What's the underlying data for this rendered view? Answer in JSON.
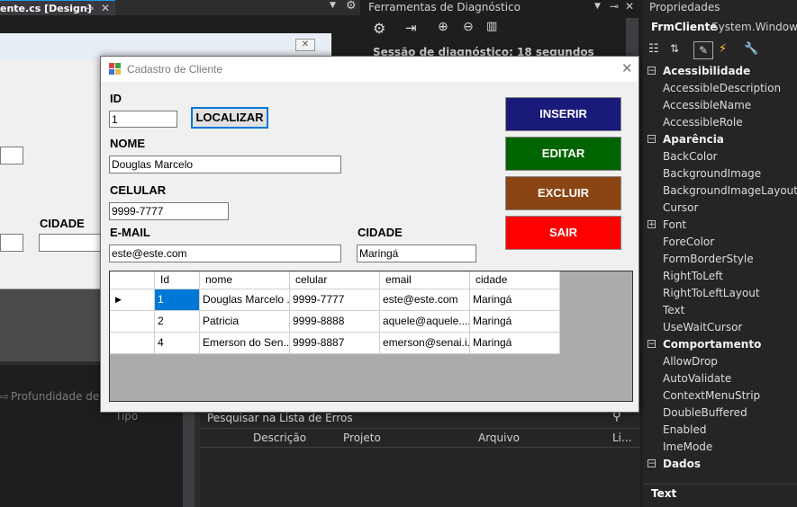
{
  "ide": {
    "designer_tab_label": "ente.cs [Design]",
    "diagnostics": {
      "title": "Ferramentas de Diagnóstico",
      "session": "Sessão de diagnóstico: 18 segundos"
    },
    "left_panel": {
      "call_stack_label": "Profundidade de P",
      "type_col": "Tipo"
    },
    "errors": {
      "search_placeholder": "Pesquisar na Lista de Erros",
      "columns": [
        "Descrição",
        "Projeto",
        "Arquivo",
        "Li..."
      ]
    },
    "properties": {
      "title": "Propriedades",
      "object_name": "FrmCliente",
      "object_type": "System.Windows.F",
      "rows": [
        {
          "type": "cat",
          "label": "Acessibilidade"
        },
        {
          "type": "item",
          "label": "AccessibleDescription"
        },
        {
          "type": "item",
          "label": "AccessibleName"
        },
        {
          "type": "item",
          "label": "AccessibleRole"
        },
        {
          "type": "cat",
          "label": "Aparência"
        },
        {
          "type": "item",
          "label": "BackColor"
        },
        {
          "type": "item",
          "label": "BackgroundImage"
        },
        {
          "type": "item",
          "label": "BackgroundImageLayout"
        },
        {
          "type": "item",
          "label": "Cursor"
        },
        {
          "type": "expand",
          "label": "Font"
        },
        {
          "type": "item",
          "label": "ForeColor"
        },
        {
          "type": "item",
          "label": "FormBorderStyle"
        },
        {
          "type": "item",
          "label": "RightToLeft"
        },
        {
          "type": "item",
          "label": "RightToLeftLayout"
        },
        {
          "type": "item",
          "label": "Text"
        },
        {
          "type": "item",
          "label": "UseWaitCursor"
        },
        {
          "type": "cat",
          "label": "Comportamento"
        },
        {
          "type": "item",
          "label": "AllowDrop"
        },
        {
          "type": "item",
          "label": "AutoValidate"
        },
        {
          "type": "item",
          "label": "ContextMenuStrip"
        },
        {
          "type": "item",
          "label": "DoubleBuffered"
        },
        {
          "type": "item",
          "label": "Enabled"
        },
        {
          "type": "item",
          "label": "ImeMode"
        },
        {
          "type": "cat",
          "label": "Dados"
        }
      ],
      "description_title": "Text"
    },
    "design_label_cidade": "CIDADE"
  },
  "dialog": {
    "title": "Cadastro de Cliente",
    "labels": {
      "id": "ID",
      "nome": "NOME",
      "celular": "CELULAR",
      "email": "E-MAIL",
      "cidade": "CIDADE"
    },
    "fields": {
      "id": "1",
      "nome": "Douglas Marcelo",
      "celular": "9999-7777",
      "email": "este@este.com",
      "cidade": "Maringá"
    },
    "buttons": {
      "localizar": "LOCALIZAR",
      "inserir": "INSERIR",
      "editar": "EDITAR",
      "excluir": "EXCLUIR",
      "sair": "SAIR"
    },
    "button_colors": {
      "inserir": "#1a1a7a",
      "editar": "#006400",
      "excluir": "#8b4513",
      "sair": "#ff0000"
    },
    "grid": {
      "columns": [
        "Id",
        "nome",
        "celular",
        "email",
        "cidade"
      ],
      "rows": [
        [
          "1",
          "Douglas Marcelo ...",
          "9999-7777",
          "este@este.com",
          "Maringá"
        ],
        [
          "2",
          "Patricia",
          "9999-8888",
          "aquele@aquele....",
          "Maringá"
        ],
        [
          "4",
          "Emerson do Sen...",
          "9999-8887",
          "emerson@senai.i...",
          "Maringá"
        ]
      ]
    }
  }
}
